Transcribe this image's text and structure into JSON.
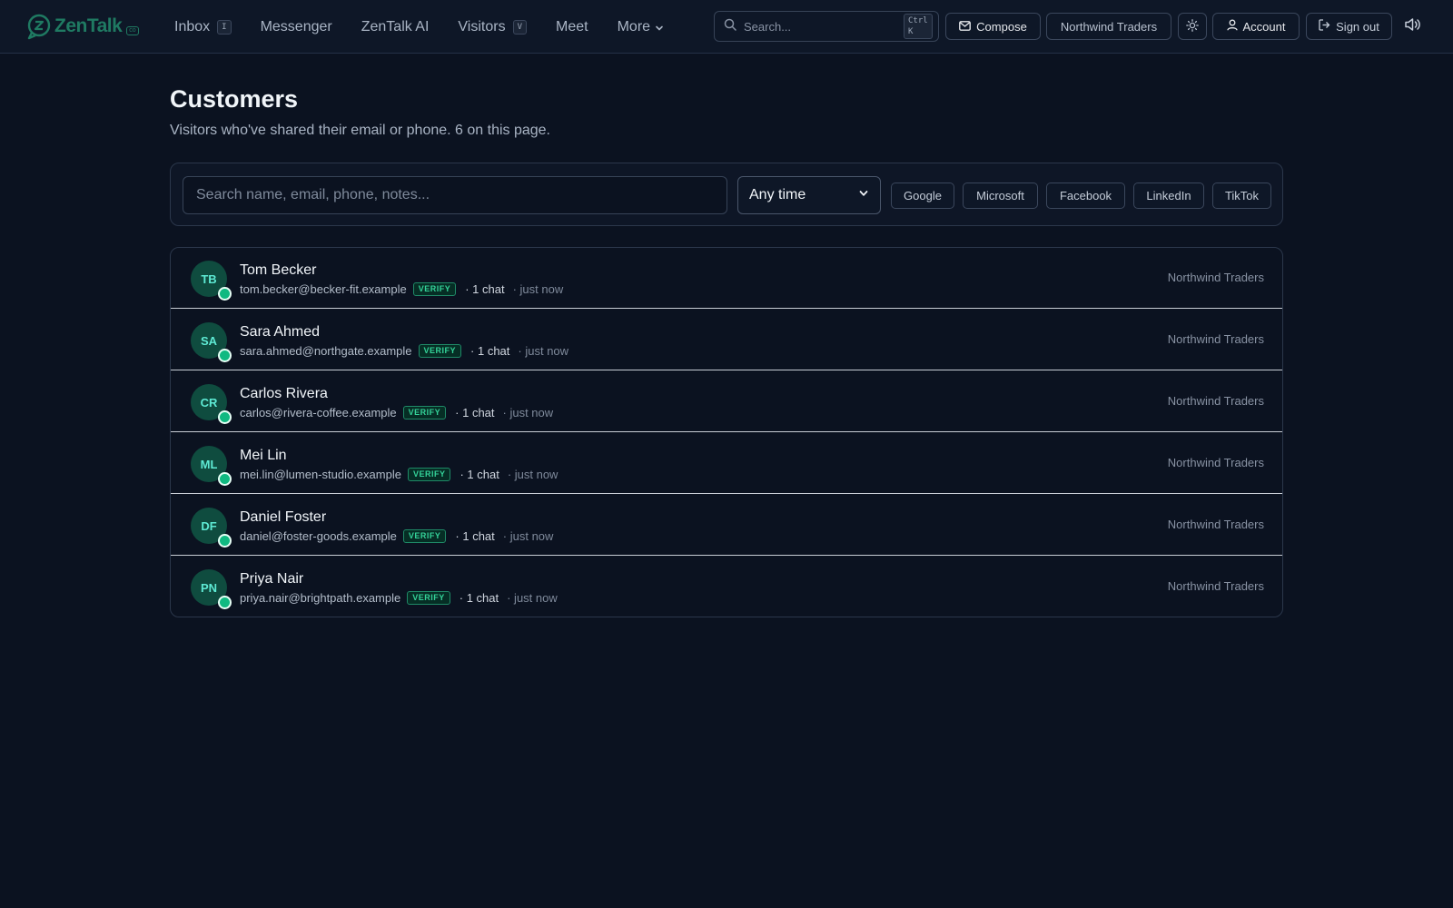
{
  "brand": {
    "name": "ZenTalk",
    "badge": "co",
    "accent": "#1f7a62"
  },
  "nav": [
    {
      "label": "Inbox",
      "kbd": "I"
    },
    {
      "label": "Messenger",
      "kbd": ""
    },
    {
      "label": "ZenTalk AI",
      "kbd": ""
    },
    {
      "label": "Visitors",
      "kbd": "V"
    },
    {
      "label": "Meet",
      "kbd": ""
    },
    {
      "label": "More",
      "kbd": ""
    }
  ],
  "top_search": {
    "placeholder": "Search...",
    "shortcut": "Ctrl K"
  },
  "toolbar": {
    "compose": "Compose",
    "workspace": "Northwind Traders",
    "account": "Account",
    "sign_out": "Sign out"
  },
  "page": {
    "title": "Customers",
    "subtitle": "Visitors who've shared their email or phone. 6 on this page."
  },
  "filters": {
    "search_placeholder": "Search name, email, phone, notes...",
    "time_selected": "Any time",
    "chips": [
      "Google",
      "Microsoft",
      "Facebook",
      "LinkedIn",
      "TikTok"
    ]
  },
  "customers": [
    {
      "initials": "TB",
      "name": "Tom Becker",
      "email": "tom.becker@becker-fit.example",
      "verify": "VERIFY",
      "chats": "· 1 chat",
      "when": "· just now",
      "org": "Northwind Traders"
    },
    {
      "initials": "SA",
      "name": "Sara Ahmed",
      "email": "sara.ahmed@northgate.example",
      "verify": "VERIFY",
      "chats": "· 1 chat",
      "when": "· just now",
      "org": "Northwind Traders"
    },
    {
      "initials": "CR",
      "name": "Carlos Rivera",
      "email": "carlos@rivera-coffee.example",
      "verify": "VERIFY",
      "chats": "· 1 chat",
      "when": "· just now",
      "org": "Northwind Traders"
    },
    {
      "initials": "ML",
      "name": "Mei Lin",
      "email": "mei.lin@lumen-studio.example",
      "verify": "VERIFY",
      "chats": "· 1 chat",
      "when": "· just now",
      "org": "Northwind Traders"
    },
    {
      "initials": "DF",
      "name": "Daniel Foster",
      "email": "daniel@foster-goods.example",
      "verify": "VERIFY",
      "chats": "· 1 chat",
      "when": "· just now",
      "org": "Northwind Traders"
    },
    {
      "initials": "PN",
      "name": "Priya Nair",
      "email": "priya.nair@brightpath.example",
      "verify": "VERIFY",
      "chats": "· 1 chat",
      "when": "· just now",
      "org": "Northwind Traders"
    }
  ]
}
